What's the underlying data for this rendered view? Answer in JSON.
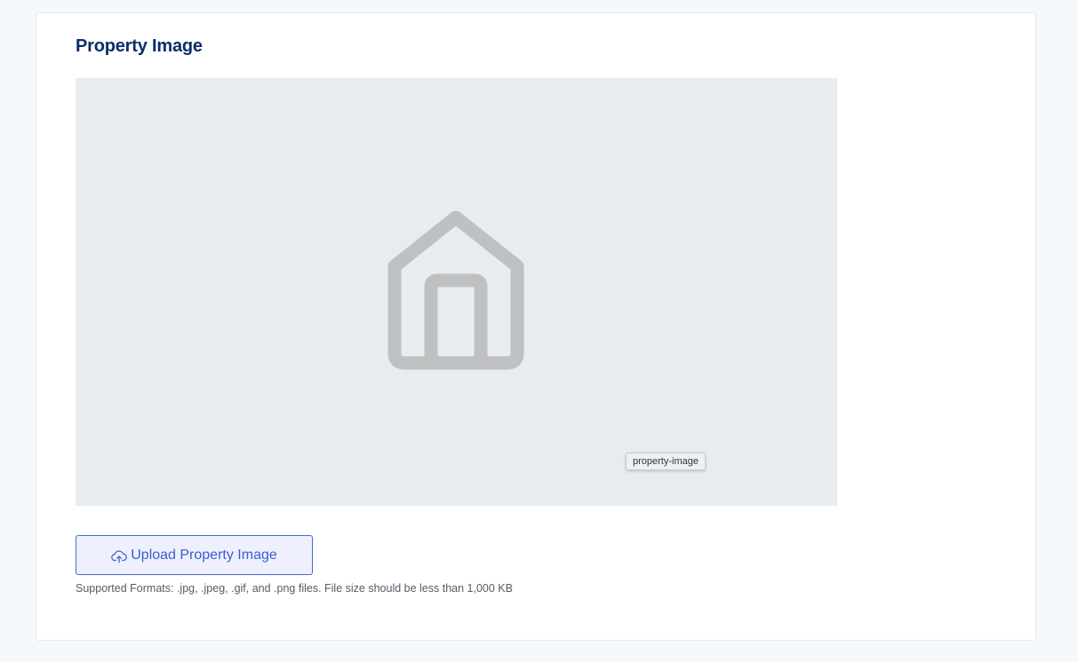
{
  "section": {
    "title": "Property Image"
  },
  "preview": {
    "placeholder_icon": "house-icon",
    "tooltip": "property-image"
  },
  "upload": {
    "icon": "cloud-upload-icon",
    "label": "Upload Property Image"
  },
  "help": {
    "text": "Supported Formats: .jpg, .jpeg, .gif, and .png files. File size should be less than 1,000 KB"
  },
  "colors": {
    "title": "#0b2e6a",
    "accent": "#3b5ccc",
    "placeholder_bg": "#e8ecef",
    "icon_gray": "#bec0c2"
  }
}
